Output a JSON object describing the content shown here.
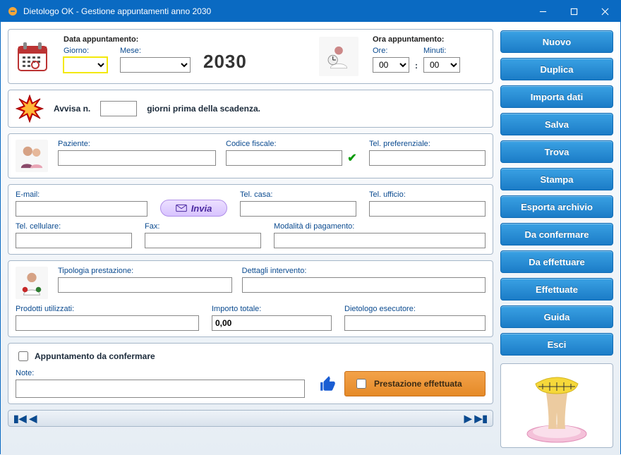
{
  "window": {
    "title": "Dietologo OK - Gestione appuntamenti anno 2030"
  },
  "date_section": {
    "header": "Data appuntamento:",
    "day_label": "Giorno:",
    "month_label": "Mese:",
    "day_value": "",
    "month_value": "",
    "year": "2030"
  },
  "time_section": {
    "header": "Ora appuntamento:",
    "hour_label": "Ore:",
    "minute_label": "Minuti:",
    "hour_value": "00",
    "minute_value": "00",
    "separator": ":"
  },
  "alert": {
    "prefix": "Avvisa n.",
    "value": "",
    "suffix": "giorni prima della scadenza."
  },
  "patient": {
    "patient_label": "Paziente:",
    "patient_value": "",
    "fiscal_label": "Codice fiscale:",
    "fiscal_value": "",
    "pref_tel_label": "Tel. preferenziale:",
    "pref_tel_value": ""
  },
  "contacts": {
    "email_label": "E-mail:",
    "email_value": "",
    "send_label": "Invia",
    "tel_casa_label": "Tel. casa:",
    "tel_casa_value": "",
    "tel_uff_label": "Tel. ufficio:",
    "tel_uff_value": "",
    "tel_cell_label": "Tel. cellulare:",
    "tel_cell_value": "",
    "fax_label": "Fax:",
    "fax_value": "",
    "pay_label": "Modalità di pagamento:",
    "pay_value": ""
  },
  "service": {
    "type_label": "Tipologia prestazione:",
    "type_value": "",
    "detail_label": "Dettagli intervento:",
    "detail_value": "",
    "products_label": "Prodotti utilizzati:",
    "products_value": "",
    "amount_label": "Importo totale:",
    "amount_value": "0,00",
    "executor_label": "Dietologo esecutore:",
    "executor_value": ""
  },
  "footer": {
    "confirm_label": "Appuntamento da confermare",
    "note_label": "Note:",
    "note_value": "",
    "done_label": "Prestazione effettuata"
  },
  "buttons": {
    "nuovo": "Nuovo",
    "duplica": "Duplica",
    "importa": "Importa dati",
    "salva": "Salva",
    "trova": "Trova",
    "stampa": "Stampa",
    "esporta": "Esporta archivio",
    "daconf": "Da confermare",
    "daeff": "Da effettuare",
    "effett": "Effettuate",
    "guida": "Guida",
    "esci": "Esci"
  }
}
